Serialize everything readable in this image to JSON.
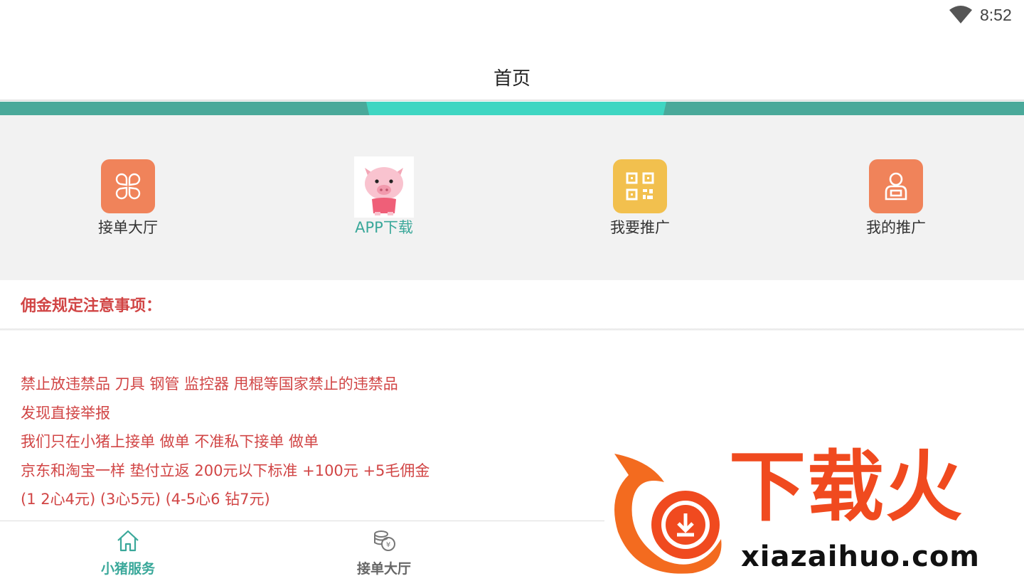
{
  "status_bar": {
    "time": "8:52"
  },
  "header": {
    "title": "首页"
  },
  "menu": {
    "items": [
      {
        "label": "接单大厅",
        "icon": "clover-icon",
        "color": "#f0835a"
      },
      {
        "label": "APP下载",
        "icon": "pig-icon",
        "color": "#3aa89a"
      },
      {
        "label": "我要推广",
        "icon": "qrcode-icon",
        "color": "#f2c04e"
      },
      {
        "label": "我的推广",
        "icon": "user-icon",
        "color": "#f0835a"
      }
    ]
  },
  "notice": {
    "title": "佣金规定注意事项：",
    "lines": [
      "禁止放违禁品 刀具 钢管 监控器 甩棍等国家禁止的违禁品",
      "发现直接举报",
      "我们只在小猪上接单 做单 不准私下接单 做单",
      "京东和淘宝一样 垫付立返 200元以下标准 +100元 +5毛佣金",
      "(1 2心4元) (3心5元) (4-5心6 钻7元)"
    ]
  },
  "bottom_nav": {
    "items": [
      {
        "label": "小猪服务",
        "icon": "home-icon"
      },
      {
        "label": "接单大厅",
        "icon": "coins-icon"
      }
    ]
  },
  "watermark": {
    "text": "下载火",
    "domain": "xiazaihuo.com"
  },
  "colors": {
    "accent": "#3aa89a",
    "notice_red": "#d14545",
    "banner": "#4aa99a"
  }
}
